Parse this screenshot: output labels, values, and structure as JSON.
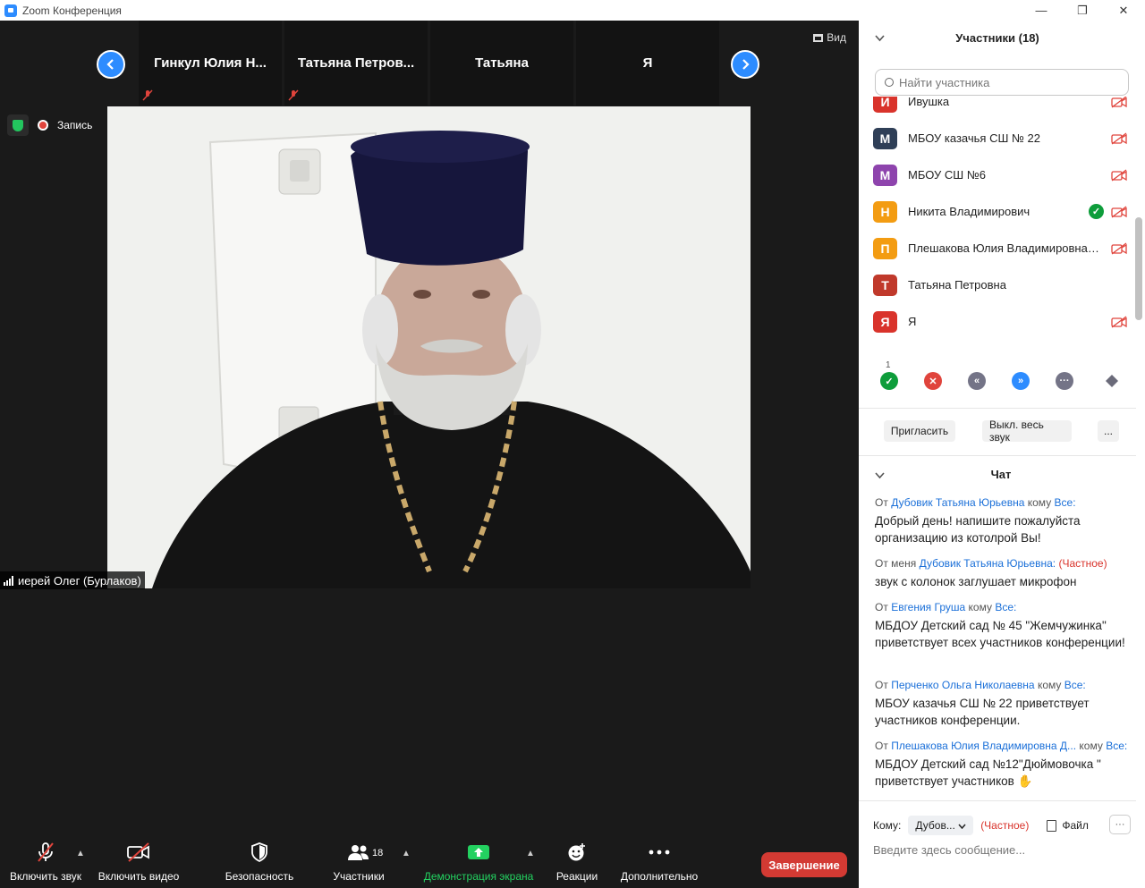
{
  "window": {
    "title": "Zoom Конференция",
    "minimize": "—",
    "restore": "❐",
    "close": "✕"
  },
  "gallery": {
    "tiles": [
      {
        "name": "Гинкул Юлия Н..."
      },
      {
        "name": "Татьяна Петров..."
      },
      {
        "name": "Татьяна"
      },
      {
        "name": "Я"
      }
    ],
    "view_label": "Вид"
  },
  "video": {
    "recording_label": "Запись",
    "speaker_name": "иерей Олег (Бурлаков)"
  },
  "toolbar": {
    "audio_label": "Включить звук",
    "video_label": "Включить видео",
    "security_label": "Безопасность",
    "participants_label": "Участники",
    "participants_count": "18",
    "share_label": "Демонстрация экрана",
    "reactions_label": "Реакции",
    "more_label": "Дополнительно",
    "end_label": "Завершение"
  },
  "participants": {
    "title": "Участники (18)",
    "search_placeholder": "Найти участника",
    "items": [
      {
        "initial": "И",
        "name": "Ивушка",
        "color": "#d9332b",
        "has_check": false,
        "video_off": true
      },
      {
        "initial": "М",
        "name": "МБОУ казачья СШ № 22",
        "color": "#2f3f57",
        "has_check": false,
        "video_off": true
      },
      {
        "initial": "М",
        "name": "МБОУ СШ №6",
        "color": "#8e44ad",
        "has_check": false,
        "video_off": true
      },
      {
        "initial": "Н",
        "name": "Никита Владимирович",
        "color": "#f39c12",
        "has_check": true,
        "video_off": true
      },
      {
        "initial": "П",
        "name": "Плешакова Юлия Владимировна ...",
        "color": "#f39c12",
        "has_check": false,
        "video_off": true
      },
      {
        "initial": "Т",
        "name": "Татьяна Петровна",
        "color": "#c0392b",
        "has_check": false,
        "video_off": false
      },
      {
        "initial": "Я",
        "name": "Я",
        "color": "#d9332b",
        "has_check": false,
        "video_off": true
      }
    ],
    "reaction_count_yes": "1",
    "invite_label": "Пригласить",
    "mute_all_label": "Выкл. весь звук",
    "more_label": "..."
  },
  "chat": {
    "title": "Чат",
    "messages": [
      {
        "prefix": "От",
        "from": "Дубовик Татьяна Юрьевна",
        "mid": "кому",
        "to": "Все:",
        "private": "",
        "text": "Добрый день! напишите пожалуйста организацию из котолрой Вы!"
      },
      {
        "prefix": "От меня",
        "from": "Дубовик Татьяна Юрьевна:",
        "mid": "",
        "to": "",
        "private": "(Частное)",
        "text": "звук с колонок заглушает микрофон"
      },
      {
        "prefix": "От",
        "from": "Евгения Груша",
        "mid": "кому",
        "to": "Все:",
        "private": "",
        "text": "МБДОУ Детский сад № 45 \"Жемчужинка\" приветствует всех участников конференции!"
      },
      {
        "prefix": "От",
        "from": "Перченко Ольга Николаевна",
        "mid": "кому",
        "to": "Все:",
        "private": "",
        "text": "МБОУ казачья СШ № 22 приветствует участников конференции."
      },
      {
        "prefix": "От",
        "from": "Плешакова Юлия Владимировна Д...",
        "mid": "кому",
        "to": "Все:",
        "private": "",
        "text": "МБДОУ Детский сад №12\"Дюймовочка \" приветствует участников ✋"
      }
    ],
    "to_label": "Кому:",
    "to_value": "Дубов...",
    "to_private": "(Частное)",
    "file_label": "Файл",
    "more_label": "···",
    "input_placeholder": "Введите здесь сообщение..."
  }
}
